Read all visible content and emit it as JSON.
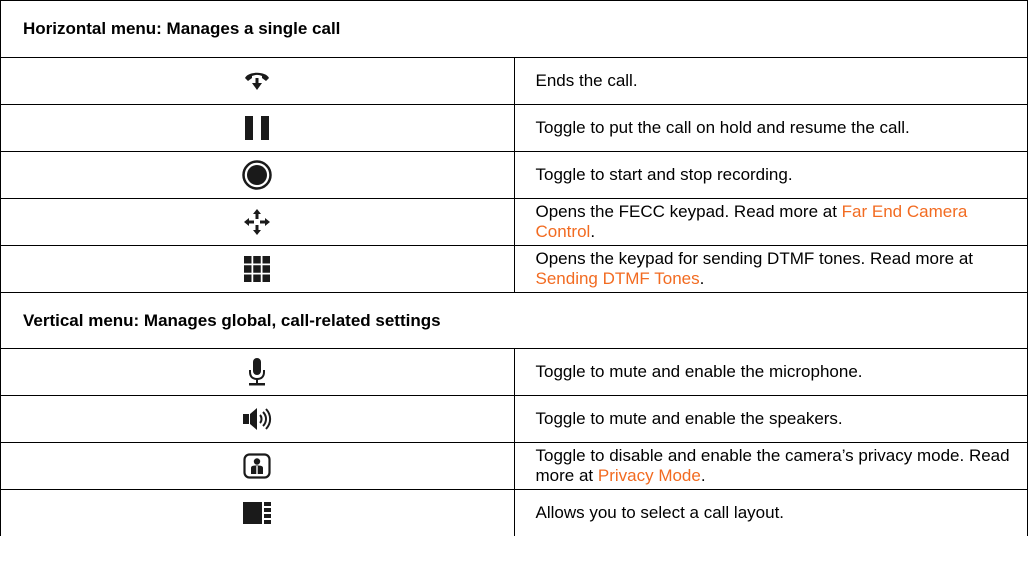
{
  "sections": [
    {
      "header": "Horizontal menu: Manages a single call",
      "rows": [
        {
          "icon": "end-call-icon",
          "text": "Ends the call."
        },
        {
          "icon": "pause-icon",
          "text": "Toggle to put the call on hold and resume the call."
        },
        {
          "icon": "record-icon",
          "text": "Toggle to start and stop recording."
        },
        {
          "icon": "move-arrows-icon",
          "text": "Opens the FECC keypad. Read more at ",
          "link": "Far End Camera Control",
          "suffix": "."
        },
        {
          "icon": "keypad-grid-icon",
          "text": "Opens the keypad for sending DTMF tones. Read more at ",
          "link": "Sending DTMF Tones",
          "suffix": "."
        }
      ]
    },
    {
      "header": "Vertical menu: Manages global, call-related settings",
      "rows": [
        {
          "icon": "microphone-icon",
          "text": "Toggle to mute and enable the microphone."
        },
        {
          "icon": "speaker-icon",
          "text": "Toggle to mute and enable the speakers."
        },
        {
          "icon": "camera-privacy-icon",
          "text": "Toggle to disable and enable the camera’s privacy mode. Read more at ",
          "link": "Privacy Mode",
          "suffix": "."
        },
        {
          "icon": "layout-icon",
          "text": "Allows you to select a call layout."
        }
      ]
    }
  ],
  "colors": {
    "link": "#f26b21",
    "border": "#000000",
    "icon": "#1a1a1a"
  }
}
